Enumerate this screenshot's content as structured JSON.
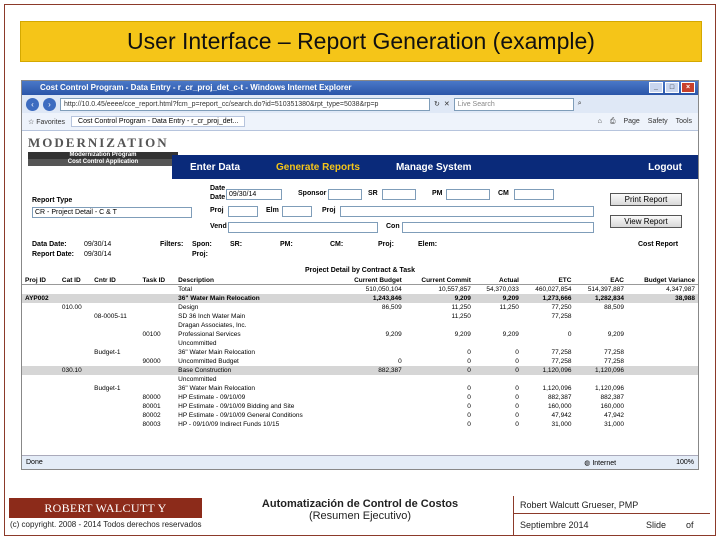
{
  "slide": {
    "title": "User Interface – Report Generation (example)"
  },
  "browser": {
    "window_title": "Cost Control Program - Data Entry - r_cr_proj_det_c-t - Windows Internet Explorer",
    "address": "http://10.0.45/eeee/cce_report.html?fcm_p=report_cc/search.do?id=510351380&rpt_type=5038&rp=p",
    "search_placeholder": "Live Search",
    "favorites_label": "Favorites",
    "tab_label": "Cost Control Program - Data Entry - r_cr_proj_det...",
    "tools": [
      "Page",
      "Safety",
      "Tools"
    ],
    "status_left": "Done",
    "status_zone": "Internet",
    "zoom": "100%"
  },
  "app": {
    "logo_text": "MODERNIZATION",
    "logo_sub1": "Modernization Program",
    "logo_sub2": "Cost Control Application",
    "menu": {
      "enter_data": "Enter Data",
      "generate_reports": "Generate Reports",
      "manage_system": "Manage System",
      "logout": "Logout"
    }
  },
  "form": {
    "report_type_label": "Report Type",
    "report_type_value": "CR - Project Detail - C & T",
    "date_label": "Date",
    "date_value": "09/30/14",
    "sponsor_label": "Sponsor",
    "sr_label": "SR",
    "pm_label": "PM",
    "cm_label": "CM",
    "proj_label": "Proj",
    "elm_label": "Elm",
    "proj2_label": "Proj",
    "vend_label": "Vend",
    "con_label": "Con",
    "print_button": "Print Report",
    "view_button": "View Report"
  },
  "info": {
    "data_date_label": "Data Date:",
    "data_date": "09/30/14",
    "report_date_label": "Report Date:",
    "report_date": "09/30/14",
    "filters_label": "Filters:",
    "spon_label": "Spon:",
    "sr_label": "SR:",
    "pm_label": "PM:",
    "cm_label": "CM:",
    "proj_label": "Proj:",
    "elem_label": "Elem:",
    "proj2_label": "Proj:",
    "report_name": "Cost Report",
    "table_title": "Project Detail by Contract & Task"
  },
  "table": {
    "headers": [
      "Proj ID",
      "Cat ID",
      "Cntr ID",
      "Task ID",
      "Description",
      "Current Budget",
      "Current Commit",
      "Actual",
      "ETC",
      "EAC",
      "Budget Variance"
    ],
    "rows": [
      {
        "cls": "",
        "cells": [
          "",
          "",
          "",
          "",
          "Total",
          "510,050,104",
          "10,557,857",
          "54,370,033",
          "460,027,854",
          "514,397,887",
          "4,347,987"
        ]
      },
      {
        "cls": "shade bold",
        "cells": [
          "AYP002",
          "",
          "",
          "",
          "36\" Water Main Relocation",
          "1,243,846",
          "9,209",
          "9,209",
          "1,273,666",
          "1,282,834",
          "38,988"
        ]
      },
      {
        "cls": "",
        "cells": [
          "",
          "010.00",
          "",
          "",
          "Design",
          "86,509",
          "11,250",
          "11,250",
          "77,250",
          "88,509",
          ""
        ]
      },
      {
        "cls": "",
        "cells": [
          "",
          "",
          "08-0005-11",
          "",
          "SD 36 Inch Water Main",
          "",
          "11,250",
          "",
          "77,258",
          "",
          ""
        ]
      },
      {
        "cls": "",
        "cells": [
          "",
          "",
          "",
          "",
          "Dragan Associates, Inc.",
          "",
          "",
          "",
          "",
          "",
          ""
        ]
      },
      {
        "cls": "",
        "cells": [
          "",
          "",
          "",
          "00100",
          "Professional Services",
          "9,209",
          "9,209",
          "9,209",
          "0",
          "9,209",
          ""
        ]
      },
      {
        "cls": "",
        "cells": [
          "",
          "",
          "",
          "",
          "Uncommitted",
          "",
          "",
          "",
          "",
          "",
          ""
        ]
      },
      {
        "cls": "",
        "cells": [
          "",
          "",
          "Budget-1",
          "",
          "36\" Water Main Relocation",
          "",
          "0",
          "0",
          "77,258",
          "77,258",
          ""
        ]
      },
      {
        "cls": "",
        "cells": [
          "",
          "",
          "",
          "90000",
          "Uncommitted Budget",
          "0",
          "0",
          "0",
          "77,258",
          "77,258",
          ""
        ]
      },
      {
        "cls": "shade",
        "cells": [
          "",
          "030.10",
          "",
          "",
          "Base Construction",
          "882,387",
          "0",
          "0",
          "1,120,096",
          "1,120,096",
          ""
        ]
      },
      {
        "cls": "",
        "cells": [
          "",
          "",
          "",
          "",
          "Uncommitted",
          "",
          "",
          "",
          "",
          "",
          ""
        ]
      },
      {
        "cls": "",
        "cells": [
          "",
          "",
          "Budget-1",
          "",
          "36\" Water Main Relocation",
          "",
          "0",
          "0",
          "1,120,096",
          "1,120,096",
          ""
        ]
      },
      {
        "cls": "",
        "cells": [
          "",
          "",
          "",
          "80000",
          "HP Estimate - 09/10/09",
          "",
          "0",
          "0",
          "882,387",
          "882,387",
          ""
        ]
      },
      {
        "cls": "",
        "cells": [
          "",
          "",
          "",
          "80001",
          "HP Estimate - 09/10/09 Bidding and Site",
          "",
          "0",
          "0",
          "160,000",
          "160,000",
          ""
        ]
      },
      {
        "cls": "",
        "cells": [
          "",
          "",
          "",
          "80002",
          "HP Estimate - 09/10/09 General Conditions",
          "",
          "0",
          "0",
          "47,942",
          "47,942",
          ""
        ]
      },
      {
        "cls": "",
        "cells": [
          "",
          "",
          "",
          "80003",
          "HP - 09/10/09 Indirect Funds 10/15",
          "",
          "0",
          "0",
          "31,000",
          "31,000",
          ""
        ]
      }
    ]
  },
  "footer": {
    "company": "ROBERT WALCUTT Y ASOCIADOS",
    "copyright": "(c) copyright. 2008 - 2014 Todos derechos reservados",
    "center_title": "Automatización de Control de Costos",
    "center_sub": "(Resumen Ejecutivo)",
    "author": "Robert Walcutt Grueser, PMP",
    "date": "Septiembre 2014",
    "slide_label": "Slide",
    "of_label": "of"
  }
}
